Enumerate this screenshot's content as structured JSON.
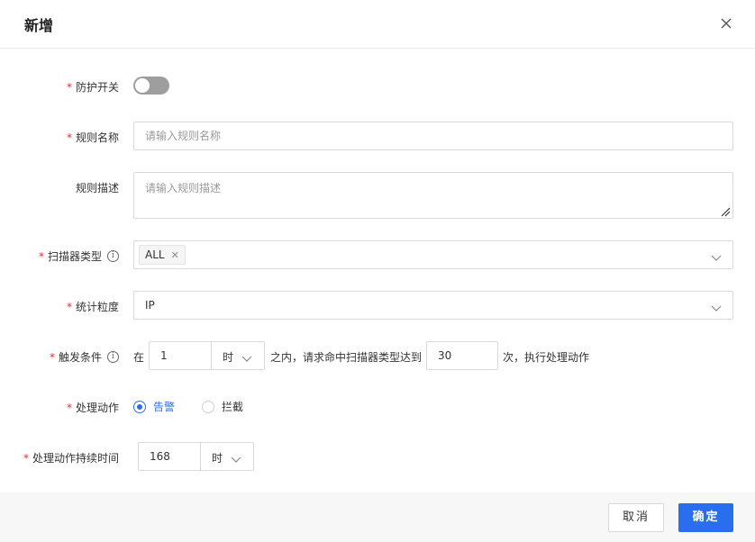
{
  "dialog": {
    "title": "新增"
  },
  "form": {
    "protection_switch": {
      "label": "防护开关",
      "enabled": false
    },
    "rule_name": {
      "label": "规则名称",
      "placeholder": "请输入规则名称",
      "value": ""
    },
    "rule_desc": {
      "label": "规则描述",
      "placeholder": "请输入规则描述",
      "value": ""
    },
    "scanner_type": {
      "label": "扫描器类型",
      "tags": [
        "ALL"
      ]
    },
    "granularity": {
      "label": "统计粒度",
      "value": "IP"
    },
    "trigger": {
      "label": "触发条件",
      "prefix": "在",
      "duration_value": "1",
      "duration_unit": "时",
      "middle_text": "之内，请求命中扫描器类型达到",
      "count_value": "30",
      "suffix": "次，执行处理动作"
    },
    "action": {
      "label": "处理动作",
      "options": [
        "告警",
        "拦截"
      ],
      "selected": "告警"
    },
    "action_duration": {
      "label": "处理动作持续时间",
      "value": "168",
      "unit": "时"
    }
  },
  "footer": {
    "cancel_label": "取消",
    "ok_label": "确定"
  },
  "colors": {
    "primary": "#2a6ef0",
    "required": "#f5222d",
    "toggle_off": "#9e9e9e"
  }
}
